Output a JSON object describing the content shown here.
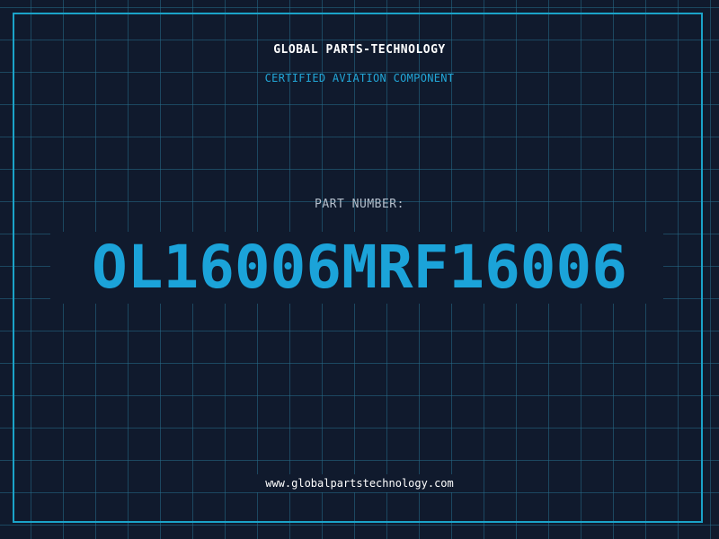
{
  "header": {
    "company_name": "GLOBAL PARTS-TECHNOLOGY",
    "tagline": "CERTIFIED AVIATION COMPONENT"
  },
  "part": {
    "label": "PART NUMBER:",
    "number": "OL16006MRF16006"
  },
  "footer": {
    "website": "www.globalpartstechnology.com"
  },
  "colors": {
    "background": "#101a2d",
    "grid": "#266c8a",
    "accent": "#1ba3d9",
    "text_primary": "#ffffff",
    "text_muted": "#b4bfcc"
  }
}
